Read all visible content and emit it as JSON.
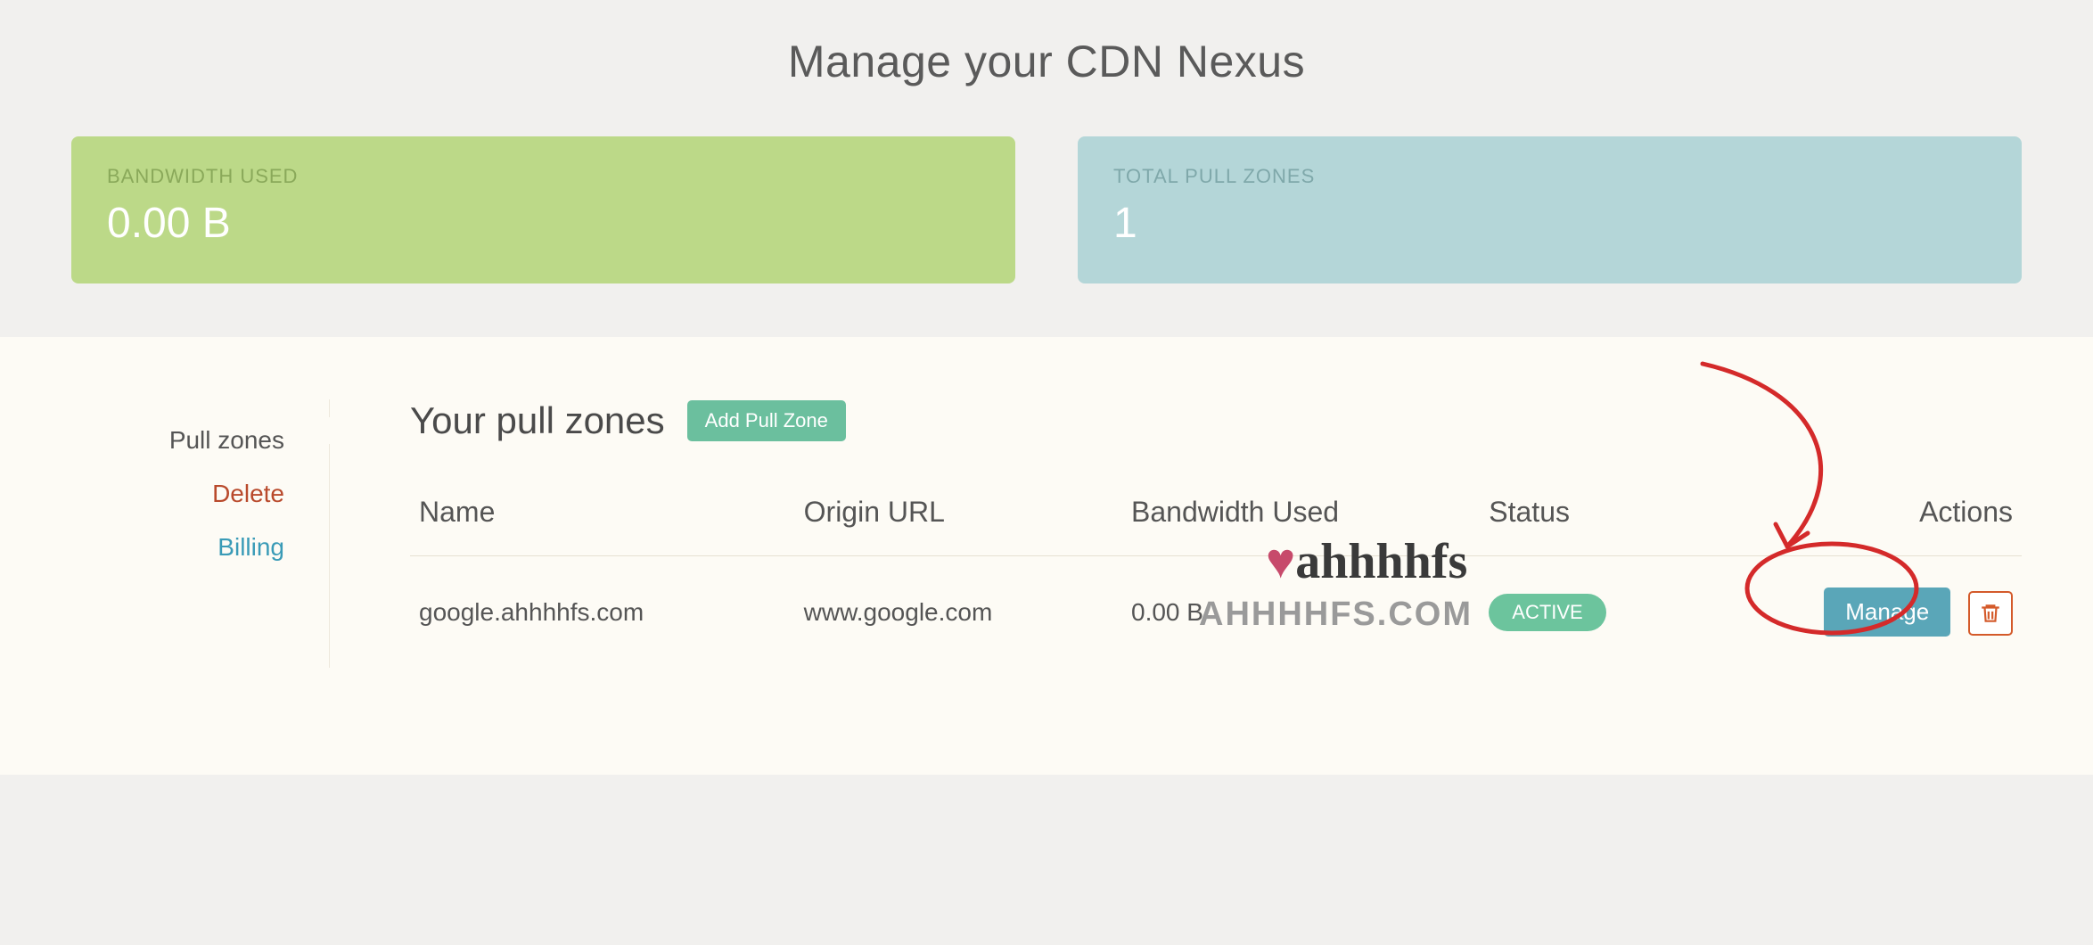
{
  "header": {
    "title": "Manage your CDN Nexus"
  },
  "stats": {
    "bandwidth": {
      "label": "BANDWIDTH USED",
      "value": "0.00 B"
    },
    "zones": {
      "label": "TOTAL PULL ZONES",
      "value": "1"
    }
  },
  "sidebar": {
    "pull_zones": "Pull zones",
    "delete": "Delete",
    "billing": "Billing"
  },
  "main": {
    "section_title": "Your pull zones",
    "add_button": "Add Pull Zone",
    "columns": {
      "name": "Name",
      "origin": "Origin URL",
      "bandwidth": "Bandwidth Used",
      "status": "Status",
      "actions": "Actions"
    },
    "rows": [
      {
        "name": "google.ahhhhfs.com",
        "origin": "www.google.com",
        "bandwidth": "0.00 B",
        "status": "ACTIVE",
        "manage_label": "Manage"
      }
    ]
  },
  "watermark": {
    "logo_text": "ahhhhfs",
    "domain_text": "AHHHHFS.COM"
  }
}
